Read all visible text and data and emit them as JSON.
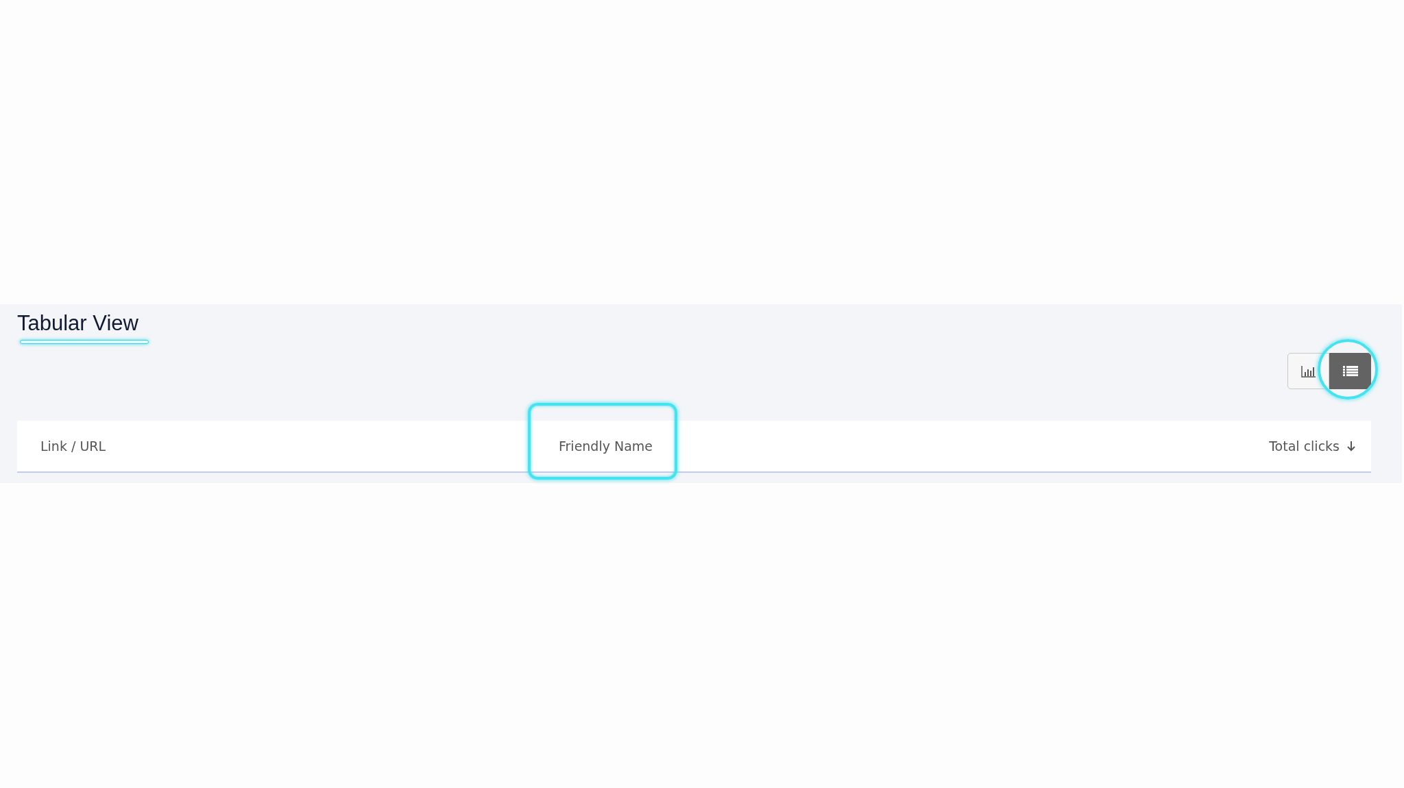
{
  "section": {
    "title": "Tabular View",
    "title_highlighted": true
  },
  "view_toggle": [
    {
      "kind": "chart",
      "selected": false,
      "highlighted": false
    },
    {
      "kind": "list",
      "selected": true,
      "highlighted": true
    }
  ],
  "table": {
    "columns": [
      {
        "label": "Link / URL",
        "sorted": false,
        "highlighted": false
      },
      {
        "label": "Friendly Name",
        "sorted": false,
        "highlighted": true
      },
      {
        "label": "Total clicks",
        "sorted": true,
        "highlighted": false
      }
    ]
  }
}
